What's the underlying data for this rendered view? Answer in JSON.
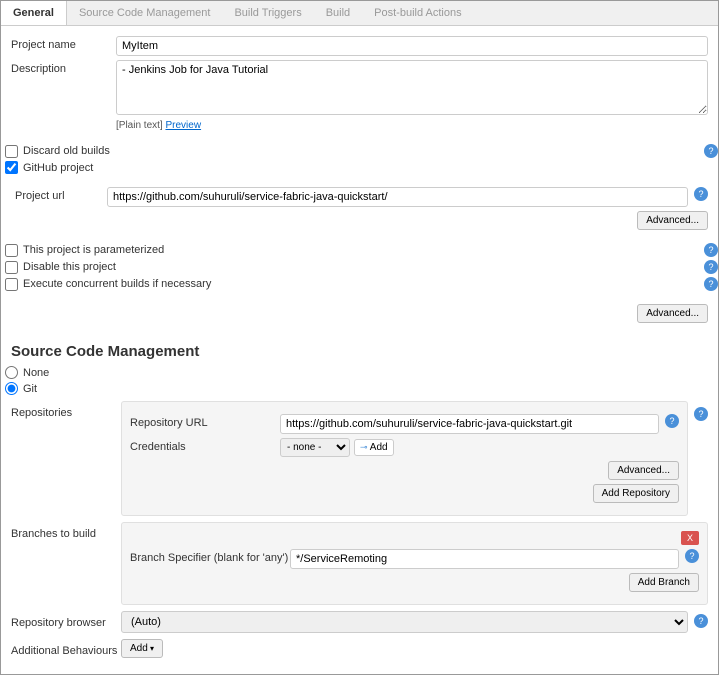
{
  "tabs": [
    "General",
    "Source Code Management",
    "Build Triggers",
    "Build",
    "Post-build Actions"
  ],
  "general": {
    "projectNameLabel": "Project name",
    "projectName": "MyItem",
    "descriptionLabel": "Description",
    "description": "- Jenkins Job for Java Tutorial",
    "plainText": "[Plain text]",
    "preview": "Preview",
    "discardOld": "Discard old builds",
    "githubProject": "GitHub project",
    "projectUrlLabel": "Project url",
    "projectUrl": "https://github.com/suhuruli/service-fabric-java-quickstart/",
    "advanced": "Advanced...",
    "parameterized": "This project is parameterized",
    "disable": "Disable this project",
    "concurrent": "Execute concurrent builds if necessary"
  },
  "scm": {
    "heading": "Source Code Management",
    "none": "None",
    "git": "Git",
    "repositoriesLabel": "Repositories",
    "repoUrlLabel": "Repository URL",
    "repoUrl": "https://github.com/suhuruli/service-fabric-java-quickstart.git",
    "credentialsLabel": "Credentials",
    "credNone": "- none -",
    "addCred": "Add",
    "advanced": "Advanced...",
    "addRepo": "Add Repository",
    "branchesLabel": "Branches to build",
    "branchSpecLabel": "Branch Specifier (blank for 'any')",
    "branchSpec": "*/ServiceRemoting",
    "addBranch": "Add Branch",
    "repoBrowserLabel": "Repository browser",
    "repoBrowser": "(Auto)",
    "additionalLabel": "Additional Behaviours",
    "addBtn": "Add"
  }
}
